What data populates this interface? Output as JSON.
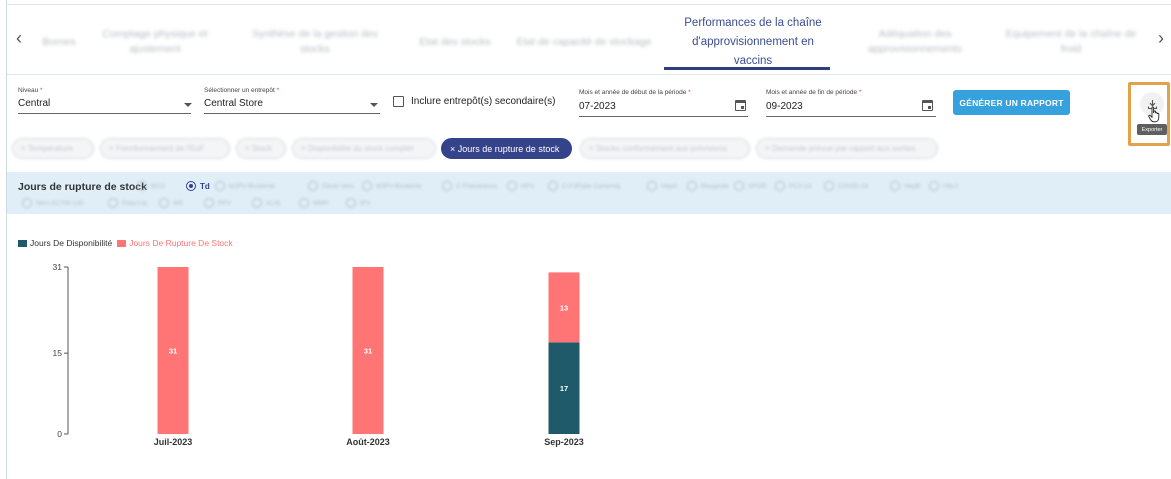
{
  "tabs": {
    "prev_icon": "chevron-left-icon",
    "next_icon": "chevron-right-icon",
    "items": [
      {
        "label": "Bornes"
      },
      {
        "label": "Comptage physique et ajustement"
      },
      {
        "label": "Synthèse de la gestion des stocks"
      },
      {
        "label": "Etat des stocks"
      },
      {
        "label": "Etat de capacité de stockage"
      },
      {
        "label": "Performances de la chaîne d'approvisionnement en vaccins"
      },
      {
        "label": "Adéquation des approvisionnements"
      },
      {
        "label": "Equipement de la chaîne de froid"
      }
    ],
    "active_index": 5
  },
  "filters": {
    "niveau": {
      "label": "Niveau",
      "required": "*",
      "value": "Central"
    },
    "entrepot": {
      "label": "Sélectionner un entrepôt",
      "required": "*",
      "value": "Central Store"
    },
    "secondary": {
      "label": "Inclure entrepôt(s) secondaire(s)",
      "checked": false
    },
    "start": {
      "label": "Mois et année de début de la période",
      "required": "*",
      "value": "07-2023"
    },
    "end": {
      "label": "Mois et année de fin de période",
      "required": "*",
      "value": "09-2023"
    },
    "generate_label": "GÉNÉRER UN RAPPORT",
    "export_tooltip": "Exporter",
    "export_icon": "download-icon"
  },
  "chips": [
    {
      "label": "Température",
      "active": false
    },
    {
      "label": "Fonctionnement de l'EoF",
      "active": false
    },
    {
      "label": "Stock",
      "active": false
    },
    {
      "label": "Disponibilité du stock complet",
      "active": false
    },
    {
      "label": "Jours de rupture de stock",
      "active": true
    },
    {
      "label": "Stocks conformément aux prévisions",
      "active": false
    },
    {
      "label": "Demande prévue par rapport aux sorties",
      "active": false
    }
  ],
  "product": {
    "title": "Jours de rupture de stock",
    "options": [
      {
        "label": "BCG",
        "selected": false
      },
      {
        "label": "Td",
        "selected": true
      },
      {
        "label": "bOPV-Bivalente",
        "selected": false
      },
      {
        "label": "Diluté Vero",
        "selected": false
      },
      {
        "label": "bOPV-Bivalente",
        "selected": false
      },
      {
        "label": "C-Fridoléance",
        "selected": false
      },
      {
        "label": "HPV",
        "selected": false
      },
      {
        "label": "C-FriFlate Comorsty",
        "selected": false
      },
      {
        "label": "HepA",
        "selected": false
      },
      {
        "label": "Rougeole",
        "selected": false
      },
      {
        "label": "VPOR",
        "selected": false
      },
      {
        "label": "PCV-13",
        "selected": false
      },
      {
        "label": "COVID-19",
        "selected": false
      },
      {
        "label": "HepB",
        "selected": false
      },
      {
        "label": "Hib-2",
        "selected": false
      },
      {
        "label": "Men-ACYW-135",
        "selected": false
      },
      {
        "label": "Rota-Liq",
        "selected": false
      },
      {
        "label": "MR",
        "selected": false
      },
      {
        "label": "PPV",
        "selected": false
      },
      {
        "label": "ALAL",
        "selected": false
      },
      {
        "label": "MMR",
        "selected": false
      },
      {
        "label": "IPV",
        "selected": false
      }
    ]
  },
  "chart_data": {
    "type": "bar",
    "stacked": true,
    "categories": [
      "Juil-2023",
      "Août-2023",
      "Sep-2023"
    ],
    "series": [
      {
        "name": "Jours De Disponibilité",
        "color": "#1f5a6b",
        "values": [
          0,
          0,
          17
        ]
      },
      {
        "name": "Jours De Rupture De Stock",
        "color": "#ff7474",
        "values": [
          31,
          31,
          13
        ]
      }
    ],
    "yticks": [
      0,
      15,
      31
    ],
    "ylim": [
      0,
      31
    ],
    "legend": "top-left",
    "grid": false
  }
}
